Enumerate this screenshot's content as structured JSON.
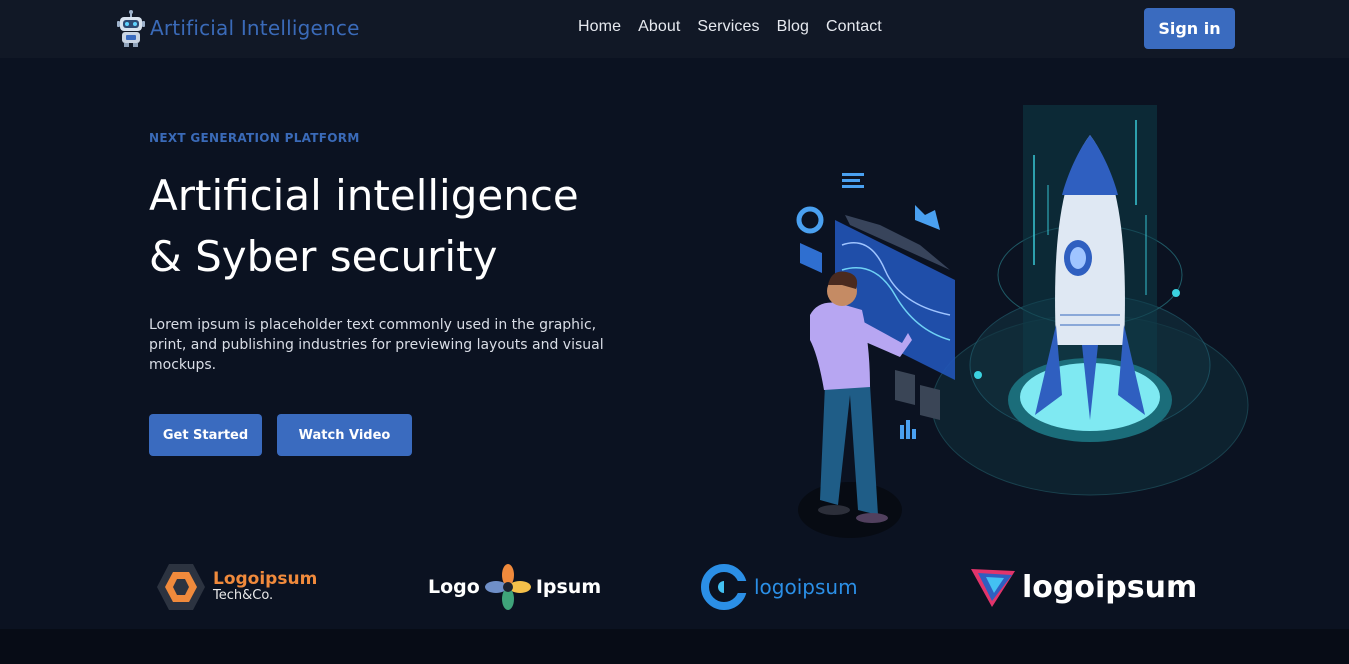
{
  "navbar": {
    "brand": "Artificial Intelligence",
    "brand_icon": "robot-icon",
    "links": [
      "Home",
      "About",
      "Services",
      "Blog",
      "Contact"
    ],
    "signin": "Sign in"
  },
  "hero": {
    "eyebrow": "NEXT GENERATION PLATFORM",
    "title_line1": "Artificial intelligence",
    "title_line2": "& Syber security",
    "description": "Lorem ipsum is placeholder text commonly used in the graphic, print, and publishing industries for previewing layouts and visual mockups.",
    "primary_button": "Get Started",
    "secondary_button": "Watch Video",
    "illustration": "rocket-launch-illustration"
  },
  "logos": [
    {
      "name": "Logoipsum",
      "sub": "Tech&Co."
    },
    {
      "left": "Logo",
      "right": "Ipsum"
    },
    {
      "name": "logoipsum"
    },
    {
      "name": "logoipsum"
    }
  ],
  "colors": {
    "accent": "#3a6bbf",
    "background": "#0b1221",
    "navbar": "#111826"
  }
}
